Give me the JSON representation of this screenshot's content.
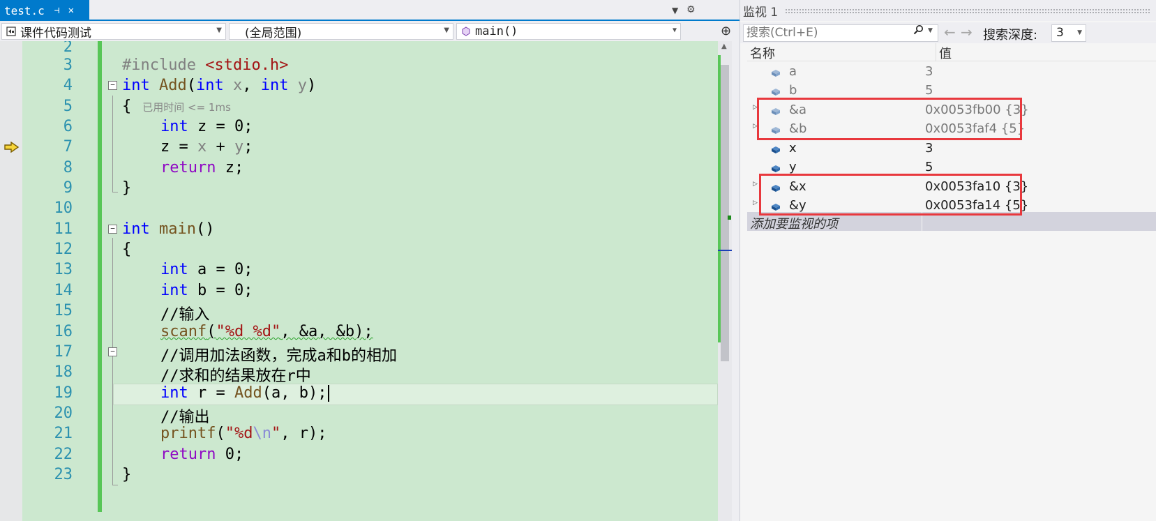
{
  "editor": {
    "tab": {
      "title": "test.c",
      "pin_glyph": "⊣",
      "close_glyph": "✕"
    },
    "nav": {
      "project": "课件代码测试",
      "scope": "(全局范围)",
      "member": "main()"
    },
    "lines": [
      {
        "num": "2"
      },
      {
        "num": "3"
      },
      {
        "num": "4"
      },
      {
        "num": "5"
      },
      {
        "num": "6"
      },
      {
        "num": "7"
      },
      {
        "num": "8"
      },
      {
        "num": "9"
      },
      {
        "num": "10"
      },
      {
        "num": "11"
      },
      {
        "num": "12"
      },
      {
        "num": "13"
      },
      {
        "num": "14"
      },
      {
        "num": "15"
      },
      {
        "num": "16"
      },
      {
        "num": "17"
      },
      {
        "num": "18"
      },
      {
        "num": "19"
      },
      {
        "num": "20"
      },
      {
        "num": "21"
      },
      {
        "num": "22"
      },
      {
        "num": "23"
      }
    ],
    "code": {
      "l3_pp": "#include ",
      "l3_hdr": "<stdio.h>",
      "l4_kw": "int",
      "l4_fn": "Add",
      "l4_open": "(",
      "l4_kw2": "int",
      "l4_p1": "x",
      "l4_comma": ", ",
      "l4_kw3": "int",
      "l4_p2": "y",
      "l4_close": ")",
      "l5_brace": "{",
      "l5_perf": "已用时间 <= 1ms",
      "l6_kw": "int",
      "l6_rest": " z = 0;",
      "l7_z": "z = ",
      "l7_x": "x",
      "l7_plus": " + ",
      "l7_y": "y",
      "l7_end": ";",
      "l8_kw": "return",
      "l8_rest": " z;",
      "l9_brace": "}",
      "l11_kw": "int",
      "l11_fn": "main",
      "l11_rest": "()",
      "l12_brace": "{",
      "l13_kw": "int",
      "l13_rest": " a = 0;",
      "l14_kw": "int",
      "l14_rest": " b = 0;",
      "l15_cmt": "//输入",
      "l16_fn": "scanf",
      "l16_open": "(",
      "l16_str": "\"%d %d\"",
      "l16_rest": ", &a, &b);",
      "l17_cmt": "//调用加法函数，完成a和b的相加",
      "l18_cmt": "//求和的结果放在r中",
      "l19_kw": "int",
      "l19_r": " r = ",
      "l19_fn": "Add",
      "l19_rest": "(a, b);",
      "l20_cmt": "//输出",
      "l21_fn": "printf",
      "l21_open": "(",
      "l21_str1": "\"%d",
      "l21_esc": "\\n",
      "l21_str2": "\"",
      "l21_rest": ", r);",
      "l22_kw": "return",
      "l22_rest": " 0;",
      "l23_brace": "}"
    }
  },
  "watch": {
    "title": "监视 1",
    "search_placeholder": "搜索(Ctrl+E)",
    "depth_label": "搜索深度:",
    "depth_value": "3",
    "col_name": "名称",
    "col_value": "值",
    "rows": [
      {
        "name": "a",
        "value": "3"
      },
      {
        "name": "b",
        "value": "5"
      },
      {
        "name": "&a",
        "value": "0x0053fb00 {3}"
      },
      {
        "name": "&b",
        "value": "0x0053faf4 {5}"
      },
      {
        "name": "x",
        "value": "3"
      },
      {
        "name": "y",
        "value": "5"
      },
      {
        "name": "&x",
        "value": "0x0053fa10 {3}"
      },
      {
        "name": "&y",
        "value": "0x0053fa14 {5}"
      }
    ],
    "add_item": "添加要监视的项"
  },
  "colors": {
    "accent": "#007acc",
    "editor_bg": "#cce8cf",
    "change_bar": "#57c657",
    "highlight_box": "#e8383d"
  }
}
